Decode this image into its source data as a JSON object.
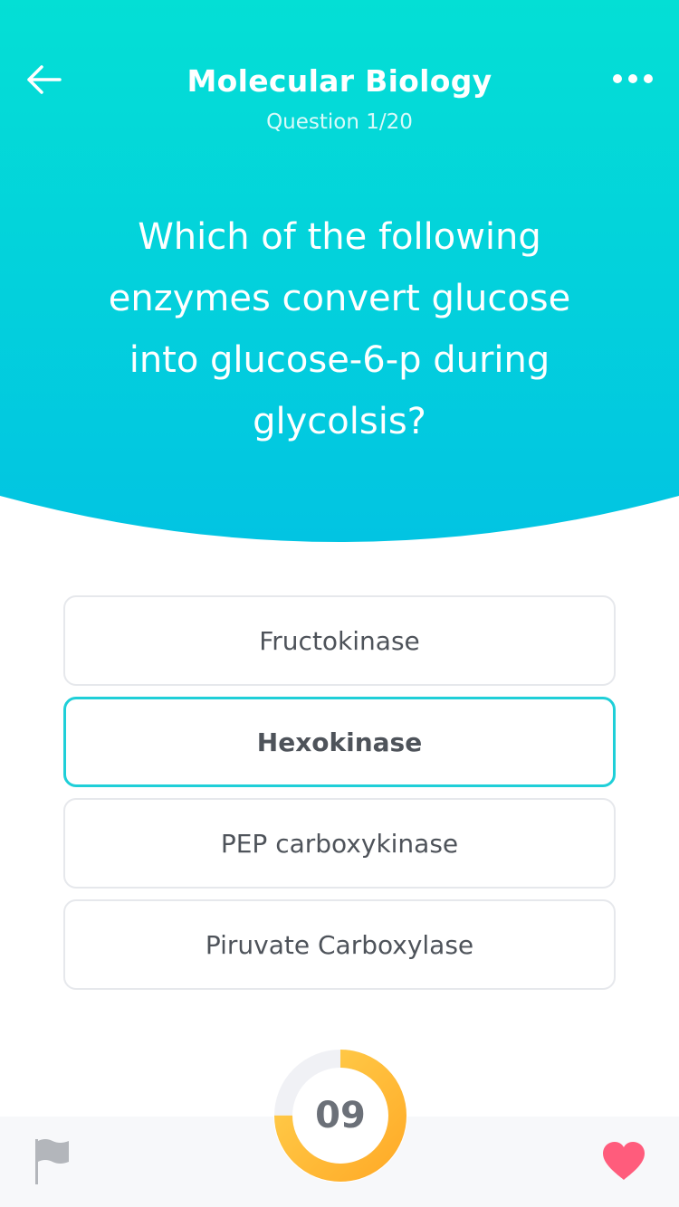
{
  "colors": {
    "header_gradient_top": "#04dfd5",
    "header_gradient_bottom": "#02c4e2",
    "accent": "#1fcfd8",
    "timer_start": "#ffcf4d",
    "timer_end": "#ffab28",
    "heart": "#ff5c7c"
  },
  "header": {
    "title": "Molecular Biology",
    "subtitle": "Question 1/20",
    "back_icon": "arrow-left-icon",
    "more_icon": "more-horizontal-icon"
  },
  "question": {
    "text": "Which of the following enzymes convert glucose into glucose-6-p during glycolsis?"
  },
  "answers": [
    {
      "label": "Fructokinase",
      "selected": false
    },
    {
      "label": "Hexokinase",
      "selected": true
    },
    {
      "label": "PEP carboxykinase",
      "selected": false
    },
    {
      "label": "Piruvate Carboxylase",
      "selected": false
    }
  ],
  "timer": {
    "value": "09",
    "progress_fraction": 0.75
  },
  "bottom_bar": {
    "flag_icon": "flag-icon",
    "heart_icon": "heart-icon"
  }
}
